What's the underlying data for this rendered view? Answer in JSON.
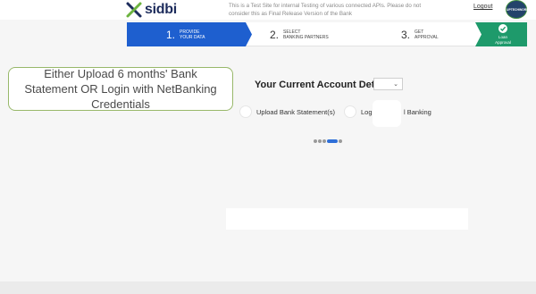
{
  "header": {
    "logo_text": "sidbi",
    "notice": "This is a Test Site for internal Testing of various connected APIs. Please do not consider this as Final Release Version of the Bank",
    "logout_label": "Logout",
    "avatar_text": "UPTECHWORLD"
  },
  "steps": [
    {
      "number": "1.",
      "label_line1": "PROVIDE",
      "label_line2": "YOUR DATA",
      "state": "active"
    },
    {
      "number": "2.",
      "label_line1": "SELECT",
      "label_line2": "BANKING PARTNERS",
      "state": "pending"
    },
    {
      "number": "3.",
      "label_line1": "GET",
      "label_line2": "APPROVAL",
      "state": "pending"
    },
    {
      "label_line1": "Loan",
      "label_line2": "Approval",
      "state": "complete",
      "icon": "check-icon"
    }
  ],
  "callout": {
    "text": "Either Upload 6 months' Bank Statement OR Login with NetBanking Credentials"
  },
  "account": {
    "title": "Your Current Account Details",
    "options": [
      {
        "label": "Upload Bank Statement(s)"
      },
      {
        "label_visible_start": "Logi",
        "label_visible_end": "l Banking"
      }
    ]
  },
  "colors": {
    "step_active": "#1e5fcf",
    "step_complete": "#1e9a6b",
    "callout_border": "#98b86a",
    "loader_active": "#2e6fd8"
  }
}
